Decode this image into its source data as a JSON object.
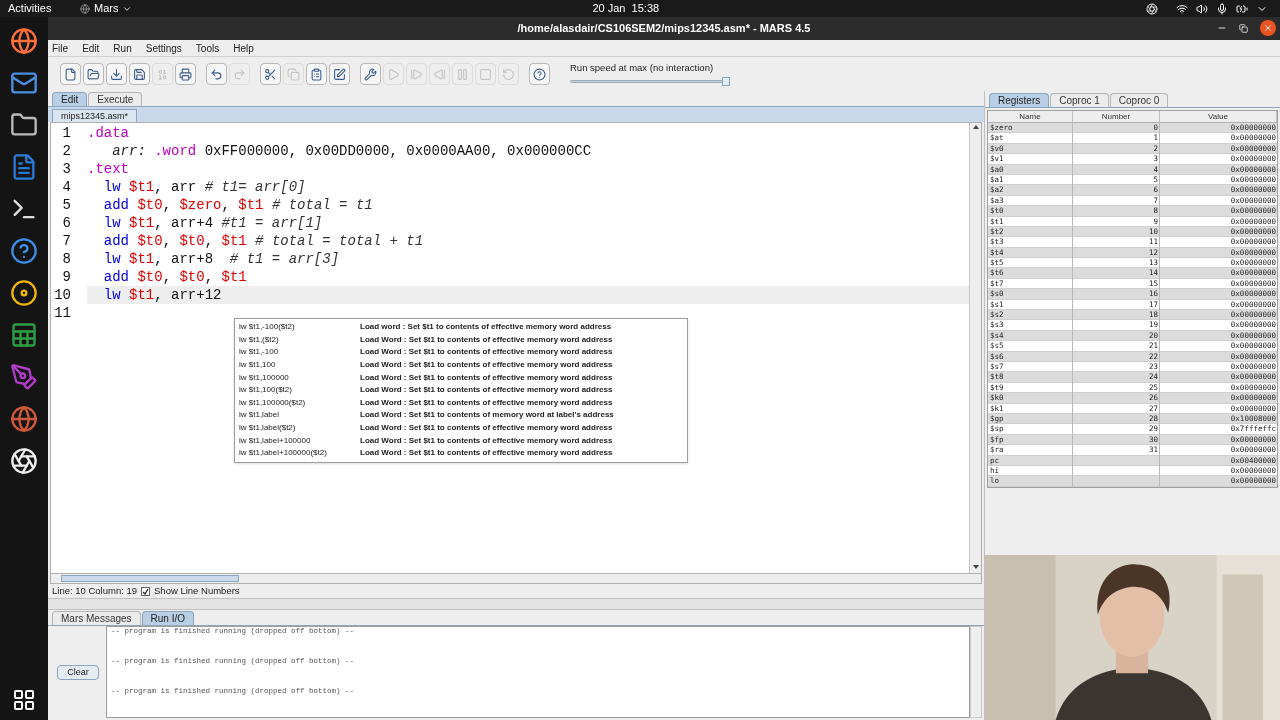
{
  "top_bar": {
    "activities": "Activities",
    "app_menu": "Mars",
    "clock": "20 Jan  15:38"
  },
  "window": {
    "title": "/home/alasdair/CS106SEM2/mips12345.asm* - MARS 4.5"
  },
  "menu": [
    "File",
    "Edit",
    "Run",
    "Settings",
    "Tools",
    "Help"
  ],
  "toolbar": [
    [
      {
        "kind": "new",
        "disabled": false
      },
      {
        "kind": "open",
        "disabled": false
      },
      {
        "kind": "save",
        "disabled": false
      },
      {
        "kind": "save_as",
        "disabled": false
      },
      {
        "kind": "dump",
        "disabled": true
      },
      {
        "kind": "print",
        "disabled": false
      }
    ],
    [
      {
        "kind": "undo",
        "disabled": false
      },
      {
        "kind": "redo",
        "disabled": true
      }
    ],
    [
      {
        "kind": "cut",
        "disabled": false
      },
      {
        "kind": "copy",
        "disabled": true
      },
      {
        "kind": "paste",
        "disabled": false
      },
      {
        "kind": "find_replace",
        "disabled": false
      }
    ],
    [
      {
        "kind": "assemble",
        "disabled": false
      },
      {
        "kind": "run",
        "disabled": true
      },
      {
        "kind": "step",
        "disabled": true
      },
      {
        "kind": "backstep",
        "disabled": true
      },
      {
        "kind": "pause",
        "disabled": true
      },
      {
        "kind": "stop",
        "disabled": true
      },
      {
        "kind": "reset",
        "disabled": true
      }
    ],
    [
      {
        "kind": "help",
        "disabled": false
      }
    ]
  ],
  "speed": {
    "label": "Run speed at max (no interaction)",
    "level": 1
  },
  "main_tabs": [
    {
      "label": "Edit",
      "selected": true
    },
    {
      "label": "Execute",
      "selected": false
    }
  ],
  "file_tab": "mips12345.asm*",
  "code": [
    {
      "number": "1",
      "current": false,
      "tokens": [
        {
          "text": ".data",
          "kind": "directive"
        }
      ]
    },
    {
      "number": "2",
      "current": false,
      "tokens": [
        {
          "text": "   arr: ",
          "kind": "label"
        },
        {
          "text": ".word ",
          "kind": "directive"
        },
        {
          "text": "0xFF000000, 0x00DD0000, 0x0000AA00, 0x000000CC",
          "kind": "plain"
        }
      ]
    },
    {
      "number": "3",
      "current": false,
      "tokens": [
        {
          "text": ".text",
          "kind": "directive"
        }
      ]
    },
    {
      "number": "4",
      "current": false,
      "tokens": [
        {
          "text": "  lw ",
          "kind": "op"
        },
        {
          "text": "$t1",
          "kind": "reg"
        },
        {
          "text": ", arr ",
          "kind": "plain"
        },
        {
          "text": "# t1= arr[0]",
          "kind": "comment"
        }
      ]
    },
    {
      "number": "5",
      "current": false,
      "tokens": [
        {
          "text": "  add ",
          "kind": "op"
        },
        {
          "text": "$t0",
          "kind": "reg"
        },
        {
          "text": ", ",
          "kind": "plain"
        },
        {
          "text": "$zero",
          "kind": "reg"
        },
        {
          "text": ", ",
          "kind": "plain"
        },
        {
          "text": "$t1",
          "kind": "reg"
        },
        {
          "text": " # total = t1",
          "kind": "comment"
        }
      ]
    },
    {
      "number": "6",
      "current": false,
      "tokens": [
        {
          "text": "  lw ",
          "kind": "op"
        },
        {
          "text": "$t1",
          "kind": "reg"
        },
        {
          "text": ", arr+4 ",
          "kind": "plain"
        },
        {
          "text": "#t1 = arr[1]",
          "kind": "comment"
        }
      ]
    },
    {
      "number": "7",
      "current": false,
      "tokens": [
        {
          "text": "  add ",
          "kind": "op"
        },
        {
          "text": "$t0",
          "kind": "reg"
        },
        {
          "text": ", ",
          "kind": "plain"
        },
        {
          "text": "$t0",
          "kind": "reg"
        },
        {
          "text": ", ",
          "kind": "plain"
        },
        {
          "text": "$t1",
          "kind": "reg"
        },
        {
          "text": " # total = total + t1",
          "kind": "comment"
        }
      ]
    },
    {
      "number": "8",
      "current": false,
      "tokens": [
        {
          "text": "  lw ",
          "kind": "op"
        },
        {
          "text": "$t1",
          "kind": "reg"
        },
        {
          "text": ", arr+8  ",
          "kind": "plain"
        },
        {
          "text": "# t1 = arr[3]",
          "kind": "comment"
        }
      ]
    },
    {
      "number": "9",
      "current": false,
      "tokens": [
        {
          "text": "  add ",
          "kind": "op"
        },
        {
          "text": "$t0",
          "kind": "reg"
        },
        {
          "text": ", ",
          "kind": "plain"
        },
        {
          "text": "$t0",
          "kind": "reg"
        },
        {
          "text": ", ",
          "kind": "plain"
        },
        {
          "text": "$t1",
          "kind": "reg"
        }
      ]
    },
    {
      "number": "10",
      "current": true,
      "tokens": [
        {
          "text": "  lw ",
          "kind": "op"
        },
        {
          "text": "$t1",
          "kind": "reg"
        },
        {
          "text": ", arr+12",
          "kind": "plain"
        }
      ]
    },
    {
      "number": "11",
      "current": false
    }
  ],
  "autocomplete": [
    {
      "syntax": "lw $t1,-100($t2)",
      "description": "Load word : Set $t1 to contents of effective memory word address"
    },
    {
      "syntax": "lw $t1,($t2)",
      "description": "Load Word : Set $t1 to contents of effective memory word address"
    },
    {
      "syntax": "lw $t1,-100",
      "description": "Load Word : Set $t1 to contents of effective memory word address"
    },
    {
      "syntax": "lw $t1,100",
      "description": "Load Word : Set $t1 to contents of effective memory word address"
    },
    {
      "syntax": "lw $t1,100000",
      "description": "Load Word : Set $t1 to contents of effective memory word address"
    },
    {
      "syntax": "lw $t1,100($t2)",
      "description": "Load Word : Set $t1 to contents of effective memory word address"
    },
    {
      "syntax": "lw $t1,100000($t2)",
      "description": "Load Word : Set $t1 to contents of effective memory word address"
    },
    {
      "syntax": "lw $t1,label",
      "description": "Load Word : Set $t1 to contents of memory word at label's address"
    },
    {
      "syntax": "lw $t1,label($t2)",
      "description": "Load Word : Set $t1 to contents of effective memory word address"
    },
    {
      "syntax": "lw $t1,label+100000",
      "description": "Load Word : Set $t1 to contents of effective memory word address"
    },
    {
      "syntax": "lw $t1,label+100000($t2)",
      "description": "Load Word : Set $t1 to contents of effective memory word address"
    }
  ],
  "status": {
    "position": "Line: 10 Column: 19",
    "show_line_numbers": {
      "label": "Show Line Numbers",
      "checked": true
    }
  },
  "message_tabs": [
    {
      "label": "Mars Messages",
      "selected": false
    },
    {
      "label": "Run I/O",
      "selected": true
    }
  ],
  "clear_button": "Clear",
  "console": [
    "-- program is finished running (dropped off bottom) --",
    "-- program is finished running (dropped off bottom) --",
    "-- program is finished running (dropped off bottom) --"
  ],
  "register_tabs": [
    {
      "label": "Registers",
      "selected": true
    },
    {
      "label": "Coproc 1",
      "selected": false
    },
    {
      "label": "Coproc 0",
      "selected": false
    }
  ],
  "registers": {
    "columns": [
      "Name",
      "Number",
      "Value"
    ],
    "rows": [
      {
        "name": "$zero",
        "number": "0",
        "value": "0x00000000"
      },
      {
        "name": "$at",
        "number": "1",
        "value": "0x00000000"
      },
      {
        "name": "$v0",
        "number": "2",
        "value": "0x00000000"
      },
      {
        "name": "$v1",
        "number": "3",
        "value": "0x00000000"
      },
      {
        "name": "$a0",
        "number": "4",
        "value": "0x00000000"
      },
      {
        "name": "$a1",
        "number": "5",
        "value": "0x00000000"
      },
      {
        "name": "$a2",
        "number": "6",
        "value": "0x00000000"
      },
      {
        "name": "$a3",
        "number": "7",
        "value": "0x00000000"
      },
      {
        "name": "$t0",
        "number": "8",
        "value": "0x00000000"
      },
      {
        "name": "$t1",
        "number": "9",
        "value": "0x00000000"
      },
      {
        "name": "$t2",
        "number": "10",
        "value": "0x00000000"
      },
      {
        "name": "$t3",
        "number": "11",
        "value": "0x00000000"
      },
      {
        "name": "$t4",
        "number": "12",
        "value": "0x00000000"
      },
      {
        "name": "$t5",
        "number": "13",
        "value": "0x00000000"
      },
      {
        "name": "$t6",
        "number": "14",
        "value": "0x00000000"
      },
      {
        "name": "$t7",
        "number": "15",
        "value": "0x00000000"
      },
      {
        "name": "$s0",
        "number": "16",
        "value": "0x00000000"
      },
      {
        "name": "$s1",
        "number": "17",
        "value": "0x00000000"
      },
      {
        "name": "$s2",
        "number": "18",
        "value": "0x00000000"
      },
      {
        "name": "$s3",
        "number": "19",
        "value": "0x00000000"
      },
      {
        "name": "$s4",
        "number": "20",
        "value": "0x00000000"
      },
      {
        "name": "$s5",
        "number": "21",
        "value": "0x00000000"
      },
      {
        "name": "$s6",
        "number": "22",
        "value": "0x00000000"
      },
      {
        "name": "$s7",
        "number": "23",
        "value": "0x00000000"
      },
      {
        "name": "$t8",
        "number": "24",
        "value": "0x00000000"
      },
      {
        "name": "$t9",
        "number": "25",
        "value": "0x00000000"
      },
      {
        "name": "$k0",
        "number": "26",
        "value": "0x00000000"
      },
      {
        "name": "$k1",
        "number": "27",
        "value": "0x00000000"
      },
      {
        "name": "$gp",
        "number": "28",
        "value": "0x10008000"
      },
      {
        "name": "$sp",
        "number": "29",
        "value": "0x7fffeffc"
      },
      {
        "name": "$fp",
        "number": "30",
        "value": "0x00000000"
      },
      {
        "name": "$ra",
        "number": "31",
        "value": "0x00000000"
      },
      {
        "name": "pc",
        "value": "0x00400000"
      },
      {
        "name": "hi",
        "value": "0x00000000"
      },
      {
        "name": "lo",
        "value": "0x00000000"
      }
    ]
  }
}
